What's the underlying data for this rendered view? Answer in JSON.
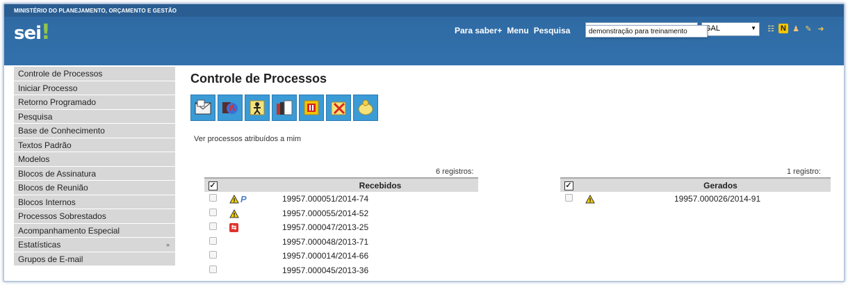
{
  "header": {
    "ministry": "MINISTÉRIO DO PLANEJAMENTO, ORÇAMENTO E GESTÃO",
    "logo": "sei",
    "logo_dot": "!",
    "nav": [
      "Para saber+",
      "Menu",
      "Pesquisa"
    ],
    "search_value": "demonstração para treinam",
    "unit_selected": "GAL",
    "autocomplete": "demonstração para treinamento",
    "tool_icons": [
      "list-icon",
      "notes-icon",
      "user-icon",
      "wrench-icon",
      "exit-icon"
    ],
    "notes_letter": "N"
  },
  "menu": [
    {
      "label": "Controle de Processos"
    },
    {
      "label": "Iniciar Processo"
    },
    {
      "label": "Retorno Programado"
    },
    {
      "label": "Pesquisa"
    },
    {
      "label": "Base de Conhecimento"
    },
    {
      "label": "Textos Padrão"
    },
    {
      "label": "Modelos"
    },
    {
      "label": "Blocos de Assinatura"
    },
    {
      "label": "Blocos de Reunião"
    },
    {
      "label": "Blocos Internos"
    },
    {
      "label": "Processos Sobrestados"
    },
    {
      "label": "Acompanhamento Especial"
    },
    {
      "label": "Estatísticas",
      "more": "»"
    },
    {
      "label": "Grupos de E-mail"
    }
  ],
  "main": {
    "title": "Controle de Processos",
    "actions": [
      "send-icon",
      "globe-icon",
      "assign-icon",
      "documents-icon",
      "pause-icon",
      "conclude-icon",
      "annotation-icon"
    ],
    "assigned_link": "Ver processos atribuídos a mim",
    "received": {
      "count": "6 registros:",
      "header": "Recebidos",
      "rows": [
        {
          "number": "19957.000051/2014-74",
          "icons": [
            "warning",
            "p"
          ]
        },
        {
          "number": "19957.000055/2014-52",
          "icons": [
            "warning"
          ]
        },
        {
          "number": "19957.000047/2013-25",
          "icons": [
            "red"
          ]
        },
        {
          "number": "19957.000048/2013-71",
          "icons": []
        },
        {
          "number": "19957.000014/2014-66",
          "icons": []
        },
        {
          "number": "19957.000045/2013-36",
          "icons": []
        }
      ]
    },
    "generated": {
      "count": "1 registro:",
      "header": "Gerados",
      "rows": [
        {
          "number": "19957.000026/2014-91",
          "icons": [
            "warning"
          ]
        }
      ]
    }
  },
  "colors": {
    "header_blue": "#3271ad",
    "ministry_bar": "#2a5d91",
    "action_blue": "#3a9bd6",
    "menu_gray": "#d7d7d7"
  }
}
